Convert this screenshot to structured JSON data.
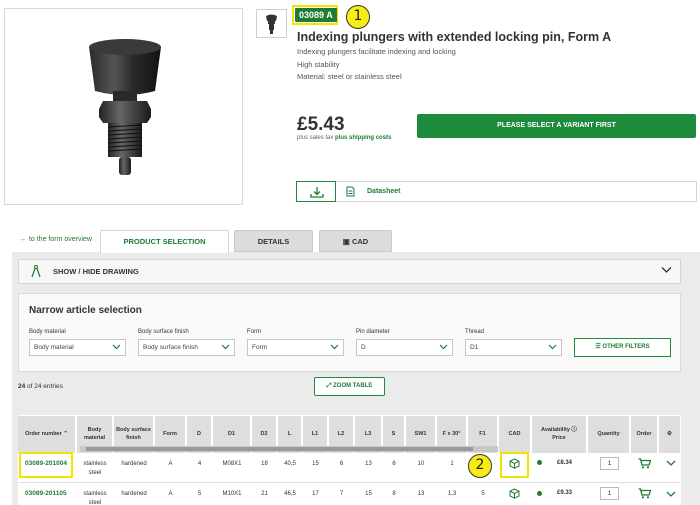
{
  "product": {
    "code": "03089 A",
    "title": "Indexing plungers with extended locking pin, Form A",
    "bullets": [
      "Indexing plungers facilitate indexing and locking",
      "High stability",
      "Material: steel or stainless steel"
    ],
    "price": "£5.43",
    "tax_note": "plus sales tax",
    "shipping_note": "plus shipping costs",
    "select_button": "PLEASE SELECT A VARIANT FIRST",
    "datasheet_label": "Datasheet"
  },
  "callouts": [
    "1",
    "2"
  ],
  "tabs": {
    "back_link": "to the form overview",
    "items": [
      "PRODUCT SELECTION",
      "DETAILS",
      "CAD"
    ],
    "active": "PRODUCT SELECTION"
  },
  "drawing_toggle": "SHOW / HIDE DRAWING",
  "filters": {
    "title": "Narrow article selection",
    "fields": [
      {
        "label": "Body material",
        "value": "Body material"
      },
      {
        "label": "Body surface finish",
        "value": "Body surface finish"
      },
      {
        "label": "Form",
        "value": "Form"
      },
      {
        "label": "Pin diameter",
        "value": "D"
      },
      {
        "label": "Thread",
        "value": "D1"
      }
    ],
    "other_filters": "OTHER FILTERS"
  },
  "entries": {
    "count": "24",
    "text": "of 24 entries"
  },
  "zoom_table": "ZOOM TABLE",
  "table": {
    "headers": [
      "Order number",
      "Body material",
      "Body surface finish",
      "Form",
      "D",
      "D1",
      "D2",
      "L",
      "L1",
      "L2",
      "L3",
      "S",
      "SW1",
      "F x 30°",
      "F1",
      "CAD",
      "Availability",
      "Price",
      "Quantity",
      "Order"
    ],
    "rows": [
      {
        "order": "03089-201004",
        "material": "stainless steel",
        "finish": "hardened",
        "form": "A",
        "d": "4",
        "d1": "M08X1",
        "d2": "18",
        "l": "40,5",
        "l1": "15",
        "l2": "6",
        "l3": "13",
        "s": "6",
        "sw1": "10",
        "f30": "1",
        "f1": "",
        "price": "£8.34",
        "qty": "1"
      },
      {
        "order": "03089-201105",
        "material": "stainless steel",
        "finish": "hardened",
        "form": "A",
        "d": "5",
        "d1": "M10X1",
        "d2": "21",
        "l": "46,5",
        "l1": "17",
        "l2": "7",
        "l3": "15",
        "s": "8",
        "sw1": "13",
        "f30": "1,3",
        "f1": "5",
        "price": "£9.33",
        "qty": "1"
      }
    ]
  },
  "colors": {
    "brand_green": "#1e8a3c",
    "highlight_yellow": "#f2e600"
  },
  "icons": [
    "plunger-thumbnail-icon",
    "download-icon",
    "document-icon",
    "back-arrow-icon",
    "cube-icon",
    "drawing-compass-icon",
    "chevron-down-icon",
    "filter-sliders-icon",
    "expand-icon",
    "sort-arrow-icon",
    "info-icon",
    "cart-icon"
  ]
}
